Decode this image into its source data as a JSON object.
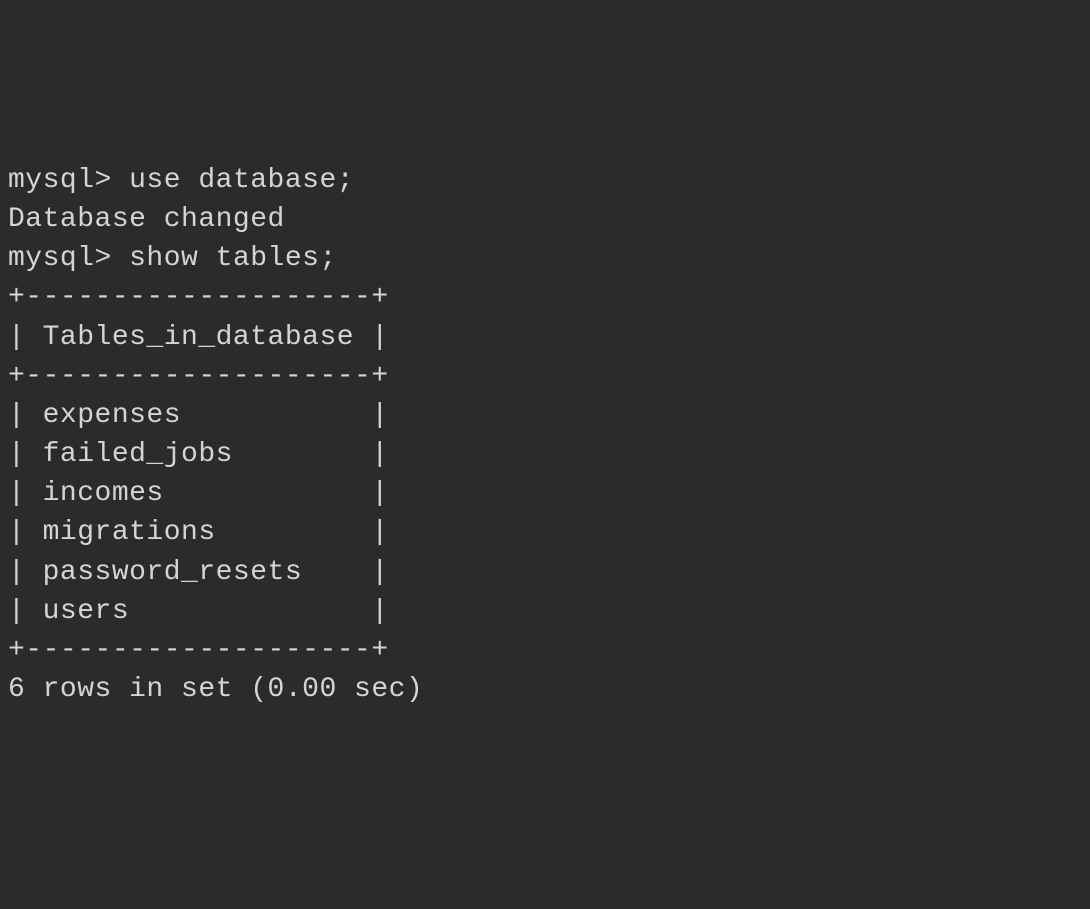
{
  "terminal": {
    "prompt": "mysql> ",
    "command1": "use database;",
    "response1": "Database changed",
    "command2": "show tables;",
    "table": {
      "divider": "+--------------------+",
      "header_row": "| Tables_in_database |",
      "rows": [
        "| expenses           |",
        "| failed_jobs        |",
        "| incomes            |",
        "| migrations         |",
        "| password_resets    |",
        "| users              |"
      ]
    },
    "footer": "6 rows in set (0.00 sec)"
  }
}
